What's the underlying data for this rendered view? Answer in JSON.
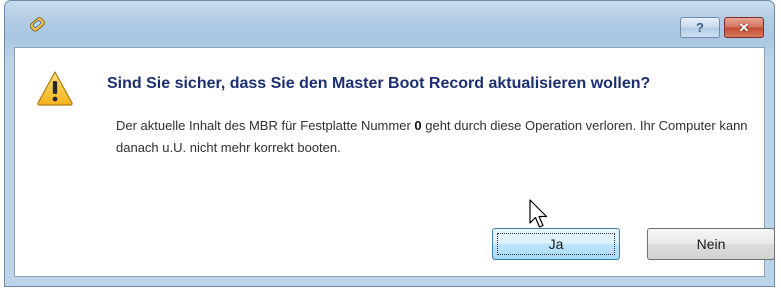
{
  "dialog": {
    "main_instruction": "Sind Sie sicher, dass Sie den Master Boot Record aktualisieren wollen?",
    "message": {
      "part1": "Der aktuelle Inhalt des MBR für Festplatte Nummer ",
      "disk_number": "0",
      "part2": " geht durch diese Operation verloren. Ihr Computer kann danach u.U. nicht mehr korrekt booten."
    }
  },
  "titlebar": {
    "help_label": "?",
    "close_label": "✕"
  },
  "buttons": {
    "yes_label": "Ja",
    "no_label": "Nein"
  },
  "icons": {
    "app": "app-icon",
    "warning": "warning-icon",
    "cursor": "mouse-cursor"
  },
  "colors": {
    "instruction_text": "#1c2f70",
    "close_button": "#c24a33",
    "default_button_border": "#3c7fb1"
  }
}
